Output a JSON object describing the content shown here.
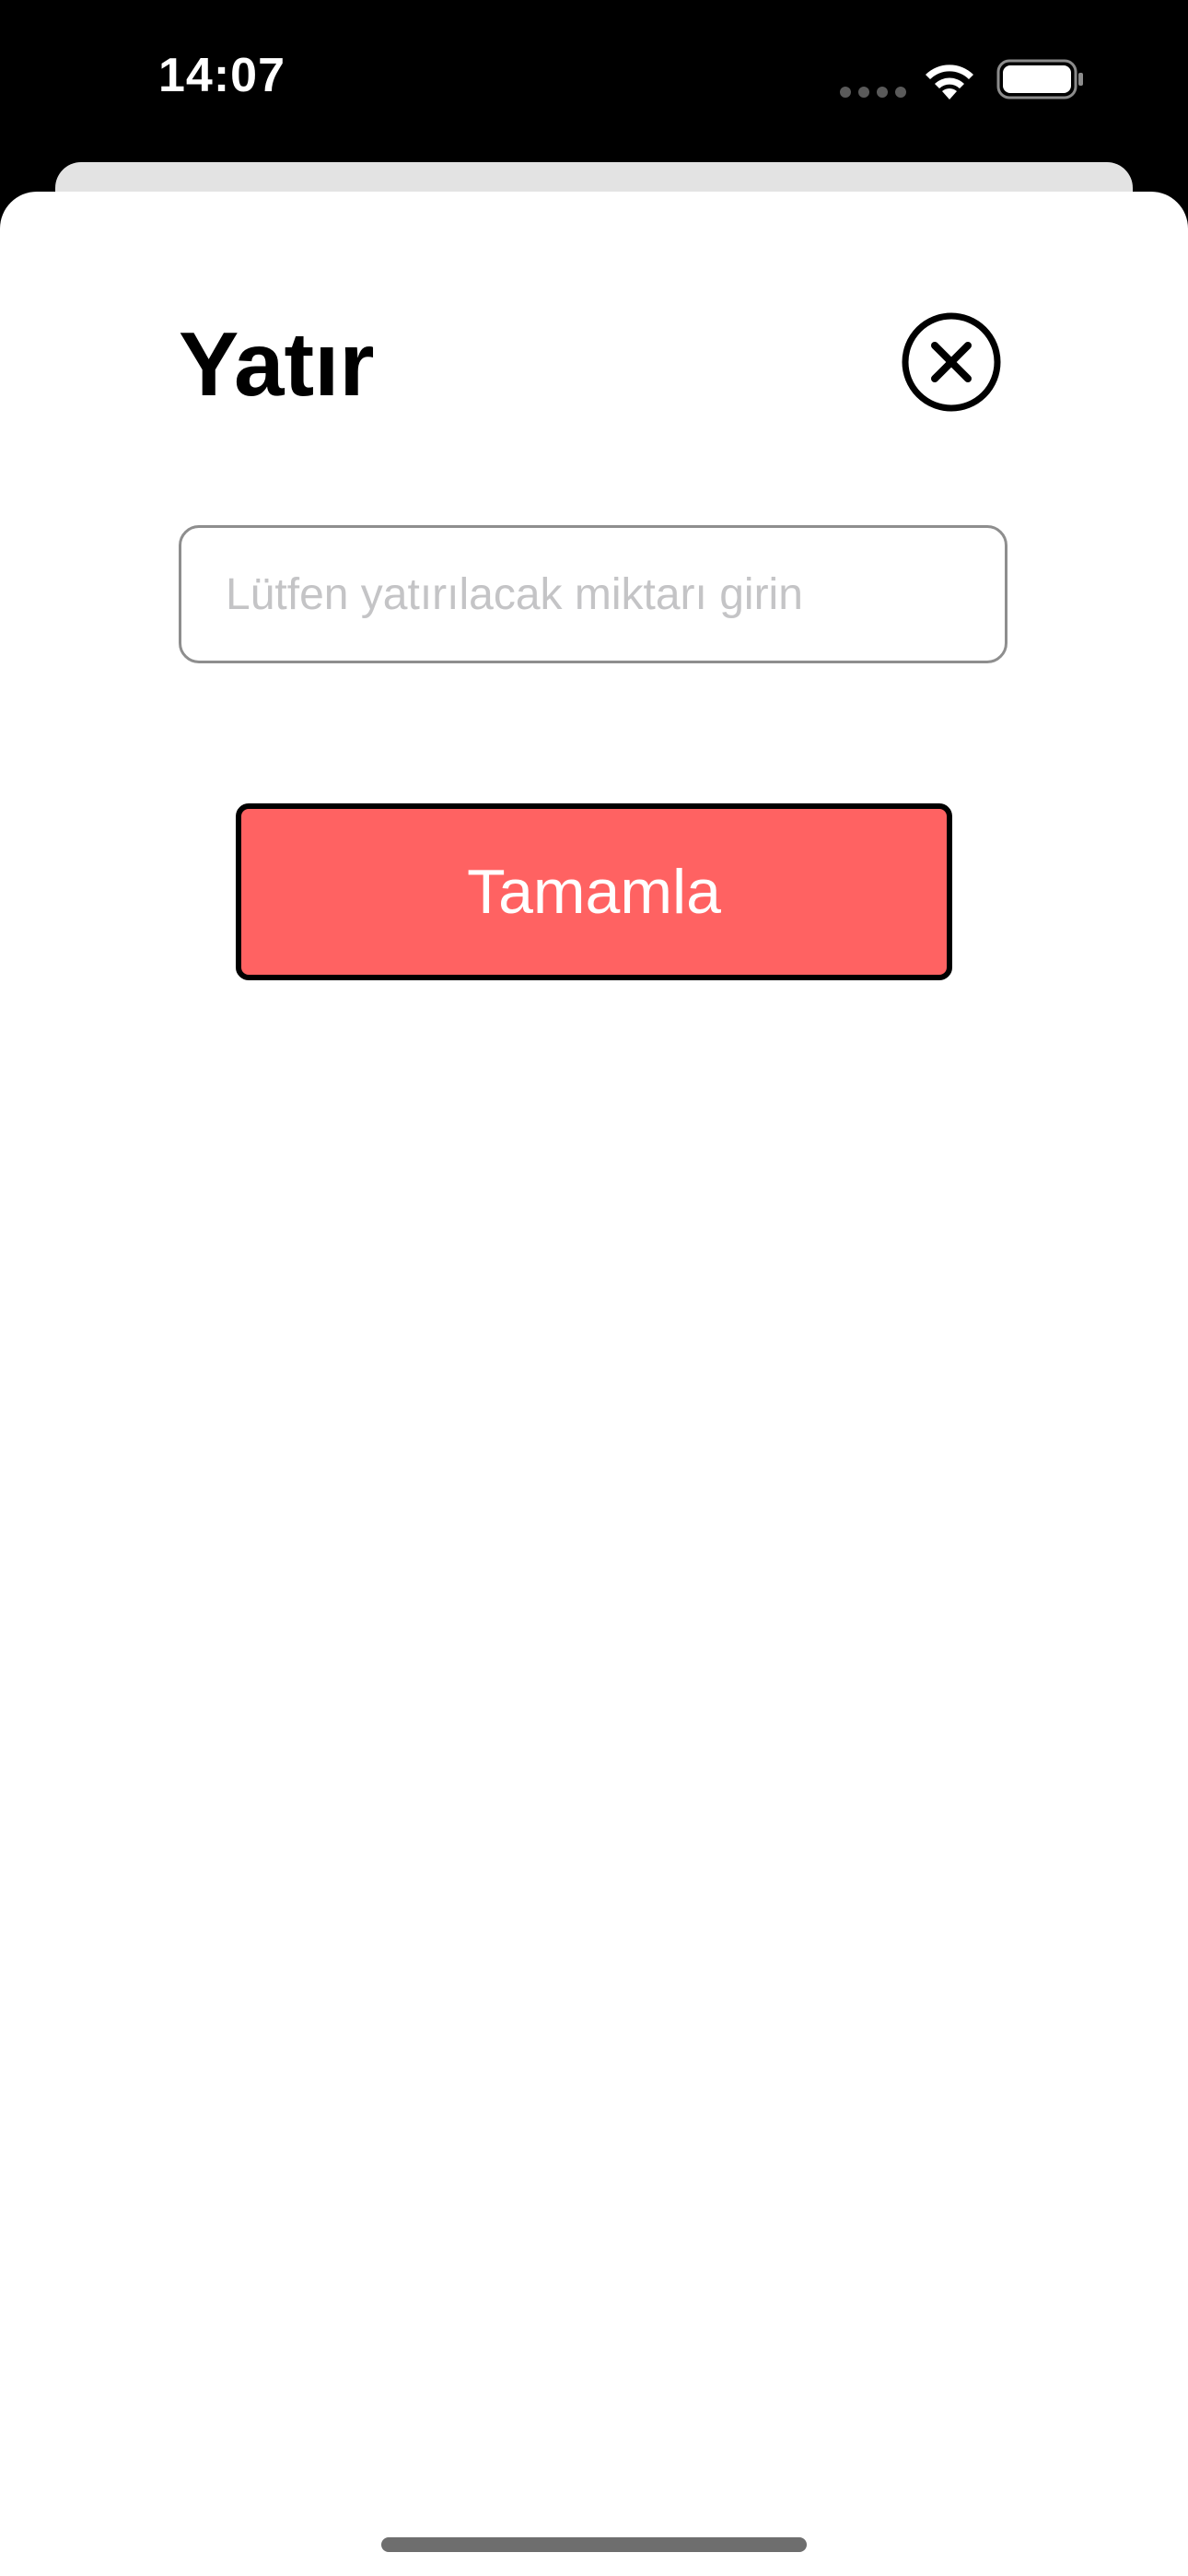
{
  "status_bar": {
    "time": "14:07",
    "icons": [
      "cellular-signal-icon",
      "wifi-icon",
      "battery-icon"
    ]
  },
  "sheet": {
    "title": "Yatır",
    "close_icon": "close-circle-icon"
  },
  "amount_field": {
    "value": "",
    "placeholder": "Lütfen yatırılacak miktarı girin"
  },
  "complete_button": {
    "label": "Tamamla"
  },
  "colors": {
    "background": "#000000",
    "sheet": "#ffffff",
    "accent_button": "#ff6262",
    "input_border": "#8e8e8e",
    "placeholder": "#c4c4c6"
  }
}
